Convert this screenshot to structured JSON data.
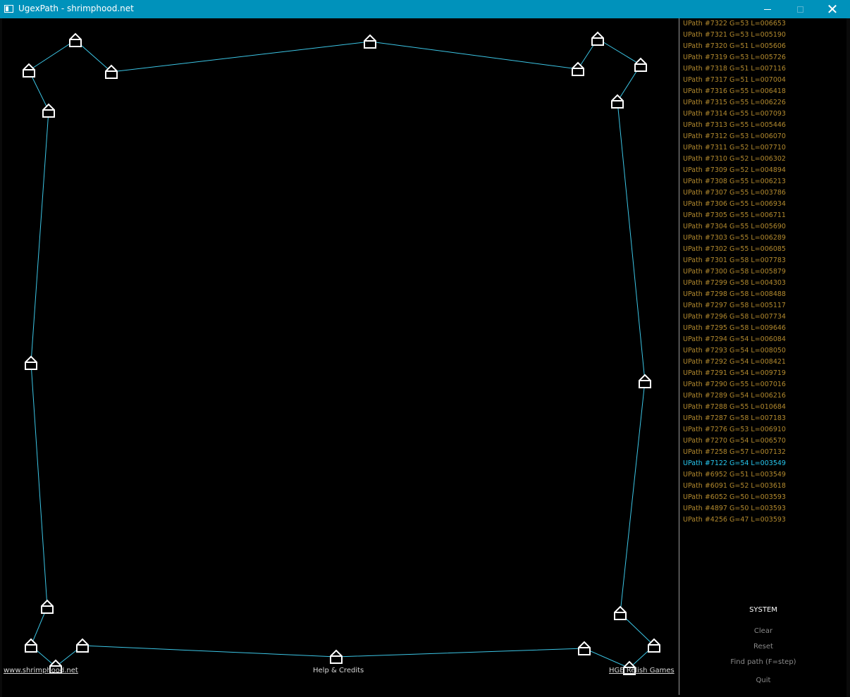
{
  "window": {
    "title": "UgexPath - shrimphood.net",
    "icon": "app-window-icon",
    "controls": [
      "minimize-icon",
      "maximize-icon",
      "close-icon"
    ],
    "close_glyph": "✕"
  },
  "colors": {
    "titlebar": "#0092bb",
    "path_line": "#3cc6e6",
    "node": "#ffffff",
    "list_text": "#b38a2e",
    "list_active": "#27c8f0",
    "menu_text": "#8a8a8a"
  },
  "path_list": [
    {
      "label": "UPath #7322  G=53  L=006653"
    },
    {
      "label": "UPath #7321  G=53  L=005190"
    },
    {
      "label": "UPath #7320  G=51  L=005606"
    },
    {
      "label": "UPath #7319  G=53  L=005726"
    },
    {
      "label": "UPath #7318  G=51  L=007116"
    },
    {
      "label": "UPath #7317  G=51  L=007004"
    },
    {
      "label": "UPath #7316  G=55  L=006418"
    },
    {
      "label": "UPath #7315  G=55  L=006226"
    },
    {
      "label": "UPath #7314  G=55  L=007093"
    },
    {
      "label": "UPath #7313  G=55  L=005446"
    },
    {
      "label": "UPath #7312  G=53  L=006070"
    },
    {
      "label": "UPath #7311  G=52  L=007710"
    },
    {
      "label": "UPath #7310  G=52  L=006302"
    },
    {
      "label": "UPath #7309  G=52  L=004894"
    },
    {
      "label": "UPath #7308  G=55  L=006213"
    },
    {
      "label": "UPath #7307  G=55  L=003786"
    },
    {
      "label": "UPath #7306  G=55  L=006934"
    },
    {
      "label": "UPath #7305  G=55  L=006711"
    },
    {
      "label": "UPath #7304  G=55  L=005690"
    },
    {
      "label": "UPath #7303  G=55  L=006289"
    },
    {
      "label": "UPath #7302  G=55  L=006085"
    },
    {
      "label": "UPath #7301  G=58  L=007783"
    },
    {
      "label": "UPath #7300  G=58  L=005879"
    },
    {
      "label": "UPath #7299  G=58  L=004303"
    },
    {
      "label": "UPath #7298  G=58  L=008488"
    },
    {
      "label": "UPath #7297  G=58  L=005117"
    },
    {
      "label": "UPath #7296  G=58  L=007734"
    },
    {
      "label": "UPath #7295  G=58  L=009646"
    },
    {
      "label": "UPath #7294  G=54  L=006084"
    },
    {
      "label": "UPath #7293  G=54  L=008050"
    },
    {
      "label": "UPath #7292  G=54  L=008421"
    },
    {
      "label": "UPath #7291  G=54  L=009719"
    },
    {
      "label": "UPath #7290  G=55  L=007016"
    },
    {
      "label": "UPath #7289  G=54  L=006216"
    },
    {
      "label": "UPath #7288  G=55  L=010684"
    },
    {
      "label": "UPath #7287  G=58  L=007183"
    },
    {
      "label": "UPath #7276  G=53  L=006910"
    },
    {
      "label": "UPath #7270  G=54  L=006570"
    },
    {
      "label": "UPath #7258  G=57  L=007132"
    },
    {
      "label": "UPath #7122  G=54  L=003549",
      "active": true
    },
    {
      "label": "UPath #6952  G=51  L=003549"
    },
    {
      "label": "UPath #6091  G=52  L=003618"
    },
    {
      "label": "UPath #6052  G=50  L=003593"
    },
    {
      "label": "UPath #4897  G=50  L=003593"
    },
    {
      "label": "UPath #4256  G=47  L=003593"
    }
  ],
  "system_menu": {
    "title": "SYSTEM",
    "items": [
      "Clear",
      "Reset",
      "Find path (F=step)",
      "Quit"
    ]
  },
  "footer": {
    "left_link": "www.shrimphood.net",
    "center": "Help & Credits",
    "right_link": "HGE Relish Games"
  }
}
